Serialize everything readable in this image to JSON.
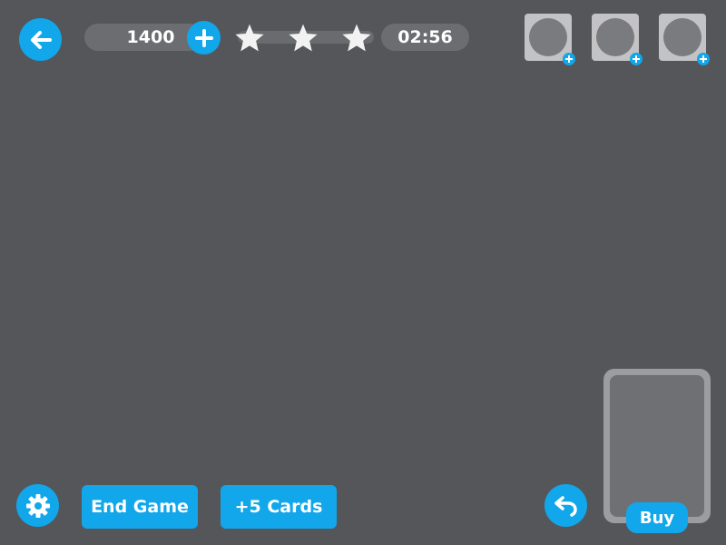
{
  "header": {
    "score": "1400",
    "timer": "02:56",
    "stars_total": 3
  },
  "icons": {
    "back": "back-arrow-icon",
    "add_score": "plus-icon",
    "star": "star-icon",
    "slot_add": "plus-icon",
    "settings": "gear-icon",
    "undo": "undo-arrow-icon"
  },
  "slots": [
    {
      "name": "powerup-slot-1"
    },
    {
      "name": "powerup-slot-2"
    },
    {
      "name": "powerup-slot-3"
    }
  ],
  "footer": {
    "end_game_label": "End Game",
    "plus_cards_label": "+5 Cards",
    "buy_label": "Buy"
  },
  "colors": {
    "background": "#55565a",
    "accent": "#11a7ea",
    "pill": "#6c6d71",
    "slot": "#c3c3c5",
    "deck": "#9c9da0"
  }
}
